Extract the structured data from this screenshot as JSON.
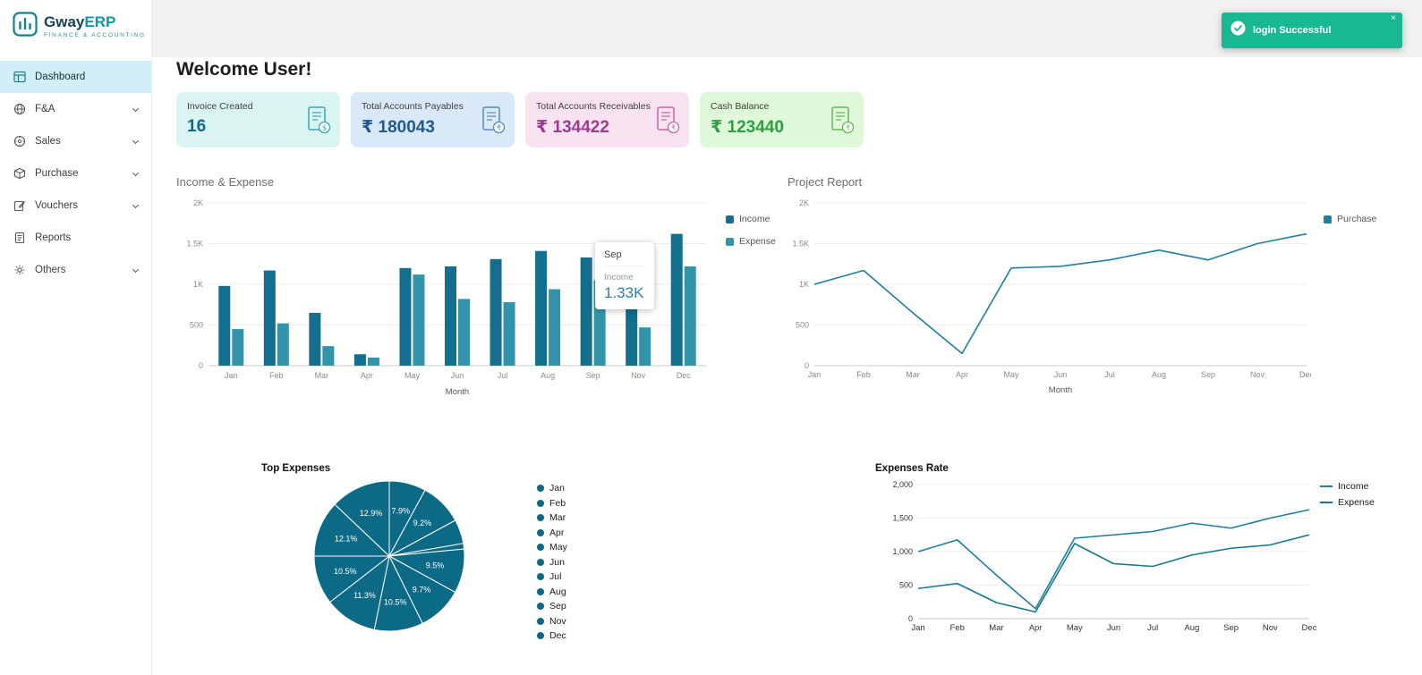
{
  "brand": {
    "name_primary": "Gway",
    "name_secondary": "ERP",
    "tagline": "FINANCE & ACCOUNTING"
  },
  "toast": {
    "message": "login Successful",
    "close_label": "×",
    "bg": "#18b893"
  },
  "sidebar": {
    "items": [
      {
        "label": "Dashboard",
        "icon": "dashboard-icon",
        "active": true,
        "chevron": false
      },
      {
        "label": "F&A",
        "icon": "globe-icon",
        "active": false,
        "chevron": true
      },
      {
        "label": "Sales",
        "icon": "sales-icon",
        "active": false,
        "chevron": true
      },
      {
        "label": "Purchase",
        "icon": "purchase-icon",
        "active": false,
        "chevron": true
      },
      {
        "label": "Vouchers",
        "icon": "vouchers-icon",
        "active": false,
        "chevron": true
      },
      {
        "label": "Reports",
        "icon": "reports-icon",
        "active": false,
        "chevron": false
      },
      {
        "label": "Others",
        "icon": "gear-icon",
        "active": false,
        "chevron": true
      }
    ]
  },
  "header": {
    "welcome": "Welcome User!"
  },
  "stat_cards": [
    {
      "label": "Invoice Created",
      "value": "16",
      "bg": "#d9f4f1",
      "value_color": "#11698e",
      "icon": "invoice-icon",
      "icon_color": "#2a9bb5",
      "badge": "$"
    },
    {
      "label": "Total Accounts Payables",
      "value": "₹ 180043",
      "bg": "#d9e9f9",
      "value_color": "#24598f",
      "icon": "payables-icon",
      "icon_color": "#4a7fb5",
      "badge": "₹"
    },
    {
      "label": "Total Accounts Receivables",
      "value": "₹ 134422",
      "bg": "#fae3f0",
      "value_color": "#9d3a91",
      "icon": "receivables-icon",
      "icon_color": "#c05a9e",
      "badge": "₹"
    },
    {
      "label": "Cash Balance",
      "value": "₹ 123440",
      "bg": "#def8d9",
      "value_color": "#2f9e44",
      "icon": "cash-icon",
      "icon_color": "#58b14c",
      "badge": "₹"
    }
  ],
  "chart_data": [
    {
      "key": "income_expense",
      "type": "bar",
      "title": "Income & Expense",
      "xlabel": "Month",
      "categories": [
        "Jan",
        "Feb",
        "Mar",
        "Apr",
        "May",
        "Jun",
        "Jul",
        "Aug",
        "Sep",
        "Nov",
        "Dec"
      ],
      "ymax": 2000,
      "yticks": [
        [
          0,
          "0"
        ],
        [
          500,
          "500"
        ],
        [
          1000,
          "1K"
        ],
        [
          1500,
          "1.5K"
        ],
        [
          2000,
          "2K"
        ]
      ],
      "legend_position": "right",
      "series": [
        {
          "name": "Income",
          "color": "#146e8e",
          "values": [
            980,
            1170,
            650,
            140,
            1200,
            1220,
            1310,
            1410,
            1330,
            1500,
            1620
          ]
        },
        {
          "name": "Expense",
          "color": "#3294aa",
          "values": [
            450,
            520,
            240,
            100,
            1120,
            820,
            780,
            940,
            1050,
            470,
            1220
          ]
        }
      ],
      "tooltip": {
        "title": "Sep",
        "series": "Income",
        "value": "1.33K"
      }
    },
    {
      "key": "project_report",
      "type": "line",
      "title": "Project Report",
      "xlabel": "Month",
      "categories": [
        "Jan",
        "Feb",
        "Mar",
        "Apr",
        "May",
        "Jun",
        "Jul",
        "Aug",
        "Sep",
        "Nov",
        "Dec"
      ],
      "ymax": 2000,
      "yticks": [
        [
          0,
          "0"
        ],
        [
          500,
          "500"
        ],
        [
          1000,
          "1K"
        ],
        [
          1500,
          "1.5K"
        ],
        [
          2000,
          "2K"
        ]
      ],
      "legend_position": "right",
      "series": [
        {
          "name": "Purchase",
          "color": "#1d809f",
          "values": [
            1000,
            1170,
            650,
            150,
            1200,
            1220,
            1300,
            1420,
            1300,
            1500,
            1620
          ]
        }
      ]
    },
    {
      "key": "top_expenses",
      "type": "pie",
      "title": "Top Expenses",
      "slice_color": "#0d6a86",
      "labels": [
        "Jan",
        "Feb",
        "Mar",
        "Apr",
        "May",
        "Jun",
        "Jul",
        "Aug",
        "Sep",
        "Nov",
        "Dec"
      ],
      "values": [
        7.9,
        9.2,
        5.2,
        1.2,
        9.5,
        9.7,
        10.5,
        11.3,
        10.5,
        12.1,
        12.9
      ],
      "value_suffix": "%",
      "min_label_pct": 6,
      "legend_position": "right"
    },
    {
      "key": "expenses_rate",
      "type": "line",
      "title": "Expenses Rate",
      "xlabel": "",
      "categories": [
        "Jan",
        "Feb",
        "Mar",
        "Apr",
        "May",
        "Jun",
        "Jul",
        "Aug",
        "Sep",
        "Nov",
        "Dec"
      ],
      "ymax": 2000,
      "yticks": [
        [
          0,
          "0"
        ],
        [
          500,
          "500"
        ],
        [
          1000,
          "1,000"
        ],
        [
          1500,
          "1,500"
        ],
        [
          2000,
          "2,000"
        ]
      ],
      "legend_position": "right",
      "series": [
        {
          "name": "Income",
          "color": "#1d7fa0",
          "values": [
            1000,
            1175,
            650,
            150,
            1200,
            1250,
            1300,
            1425,
            1350,
            1500,
            1625
          ]
        },
        {
          "name": "Expense",
          "color": "#15798c",
          "values": [
            450,
            525,
            240,
            100,
            1120,
            820,
            780,
            950,
            1050,
            1100,
            1250
          ]
        }
      ]
    }
  ]
}
